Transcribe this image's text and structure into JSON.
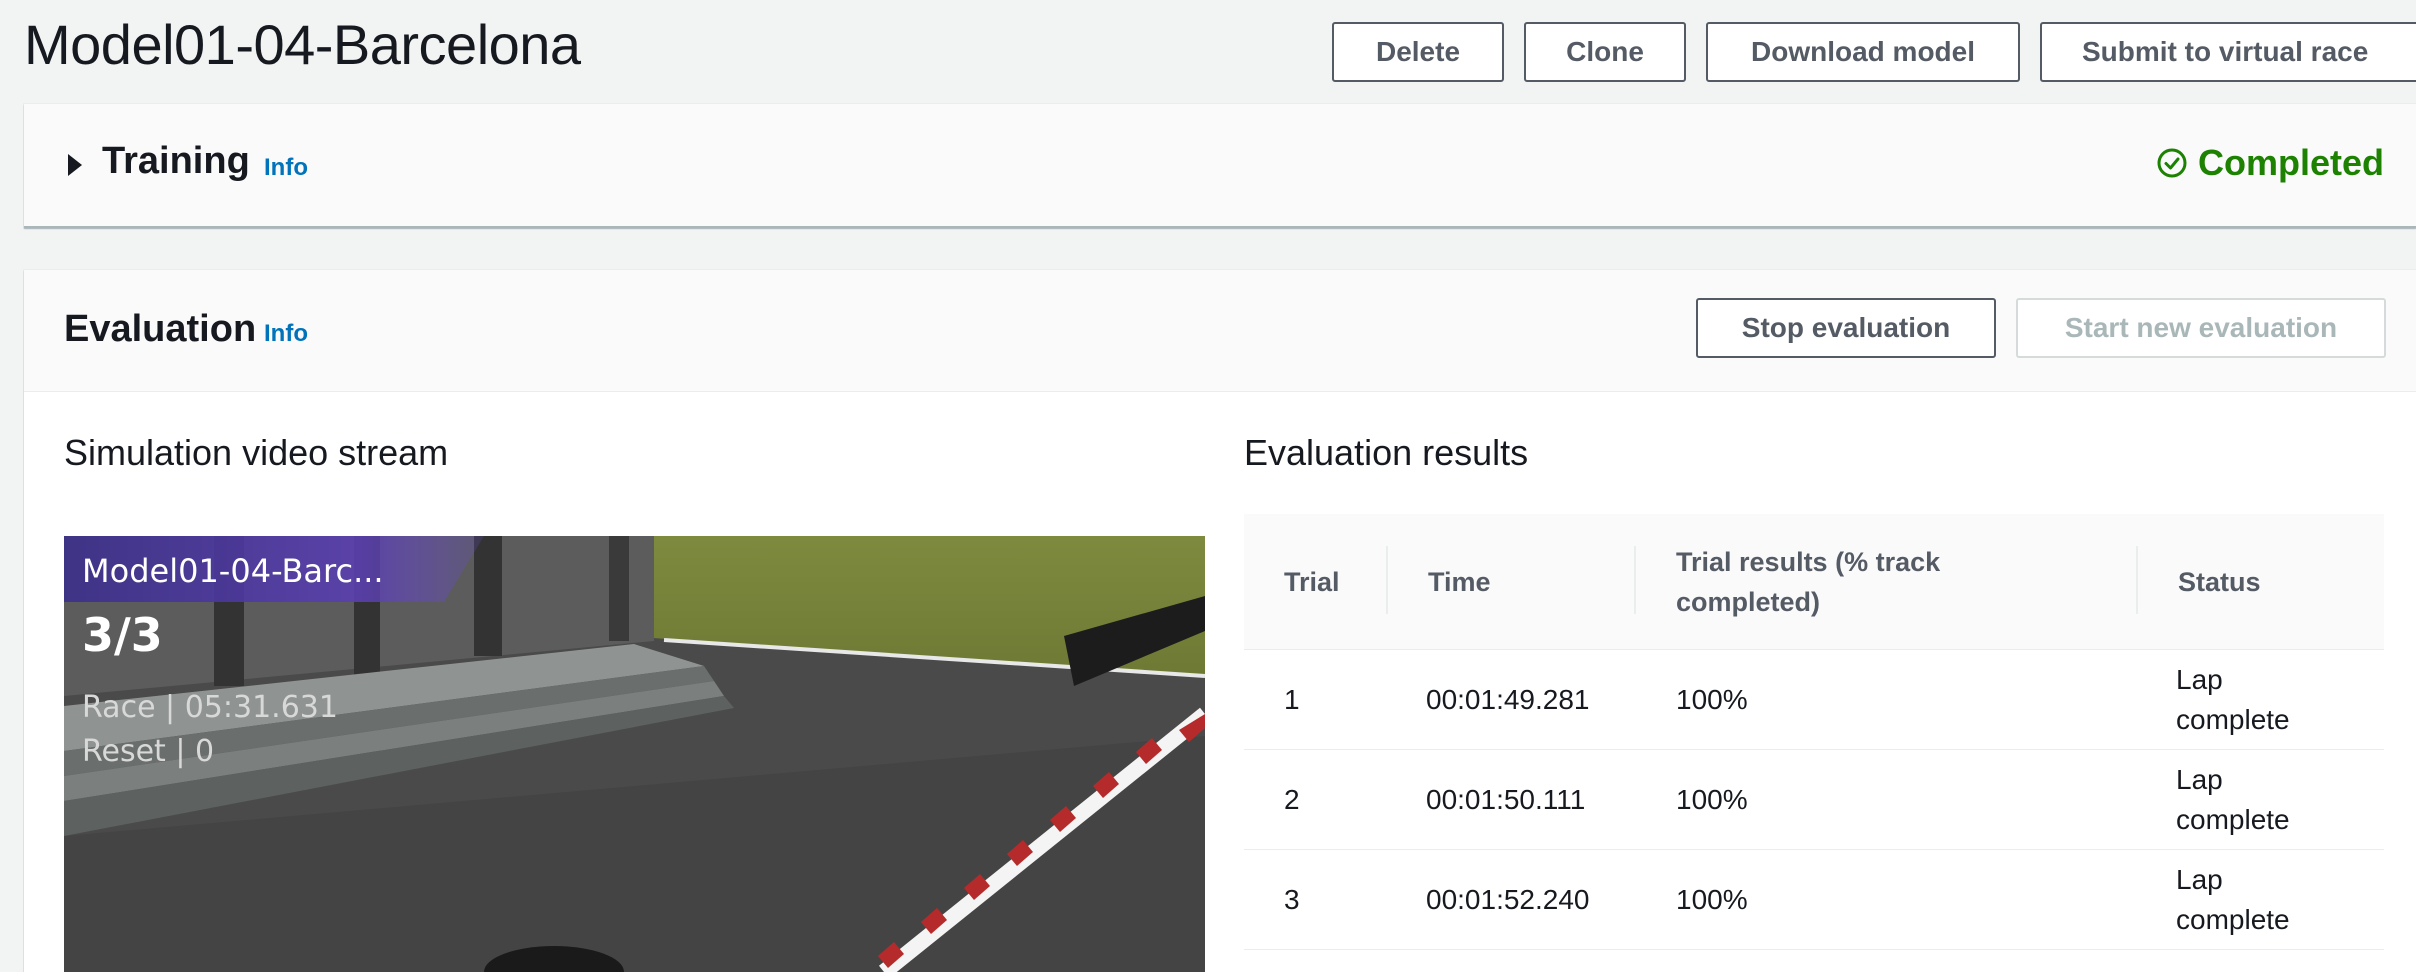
{
  "header": {
    "title": "Model01-04-Barcelona",
    "buttons": {
      "delete": "Delete",
      "clone": "Clone",
      "download": "Download model",
      "submit": "Submit to virtual race"
    }
  },
  "training": {
    "title": "Training",
    "info": "Info",
    "status": "Completed",
    "status_color": "#1d8102"
  },
  "evaluation": {
    "title": "Evaluation",
    "info": "Info",
    "stop_label": "Stop evaluation",
    "start_label": "Start new evaluation",
    "video": {
      "title": "Simulation video stream",
      "overlay_model": "Model01-04-Barc...",
      "overlay_lap": "3/3",
      "overlay_race": "Race | 05:31.631",
      "overlay_reset": "Reset | 0"
    },
    "results": {
      "title": "Evaluation results",
      "columns": [
        "Trial",
        "Time",
        "Trial results (% track completed)",
        "Status"
      ],
      "rows": [
        {
          "trial": "1",
          "time": "00:01:49.281",
          "result": "100%",
          "status": "Lap complete"
        },
        {
          "trial": "2",
          "time": "00:01:50.111",
          "result": "100%",
          "status": "Lap complete"
        },
        {
          "trial": "3",
          "time": "00:01:52.240",
          "result": "100%",
          "status": "Lap complete"
        }
      ]
    }
  }
}
